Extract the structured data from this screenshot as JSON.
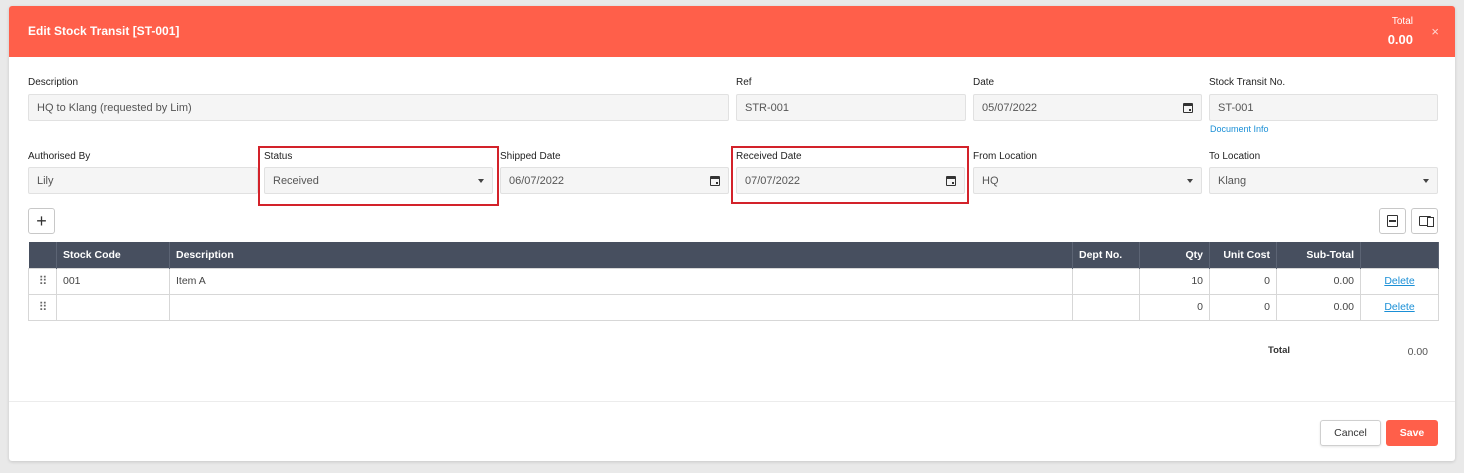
{
  "header": {
    "title": "Edit Stock Transit [ST-001]",
    "total_label": "Total",
    "total_value": "0.00",
    "close_glyph": "×"
  },
  "form": {
    "description": {
      "label": "Description",
      "value": "HQ to Klang (requested by Lim)"
    },
    "ref": {
      "label": "Ref",
      "value": "STR-001"
    },
    "date": {
      "label": "Date",
      "value": "05/07/2022"
    },
    "stock_transit_no": {
      "label": "Stock Transit No.",
      "value": "ST-001",
      "link": "Document Info"
    },
    "authorised_by": {
      "label": "Authorised By",
      "value": "Lily"
    },
    "status": {
      "label": "Status",
      "value": "Received"
    },
    "shipped_date": {
      "label": "Shipped Date",
      "value": "06/07/2022"
    },
    "received_date": {
      "label": "Received Date",
      "value": "07/07/2022"
    },
    "from_location": {
      "label": "From Location",
      "value": "HQ"
    },
    "to_location": {
      "label": "To Location",
      "value": "Klang"
    }
  },
  "toolbar": {
    "add_glyph": "+"
  },
  "table": {
    "columns": [
      "",
      "Stock Code",
      "Description",
      "Dept No.",
      "Qty",
      "Unit Cost",
      "Sub-Total",
      ""
    ],
    "rows": [
      {
        "stock_code": "001",
        "description": "Item A",
        "dept_no": "",
        "qty": "10",
        "unit_cost": "0",
        "sub_total": "0.00",
        "action": "Delete"
      },
      {
        "stock_code": "",
        "description": "",
        "dept_no": "",
        "qty": "0",
        "unit_cost": "0",
        "sub_total": "0.00",
        "action": "Delete"
      }
    ],
    "drag_glyph": "⠿"
  },
  "summary": {
    "total_label": "Total",
    "total_value": "0.00"
  },
  "footer": {
    "cancel_label": "Cancel",
    "save_label": "Save"
  },
  "colors": {
    "accent": "#ff5f4a",
    "table_header": "#474f5f",
    "highlight": "#d3222a",
    "link": "#1a8fd6"
  }
}
